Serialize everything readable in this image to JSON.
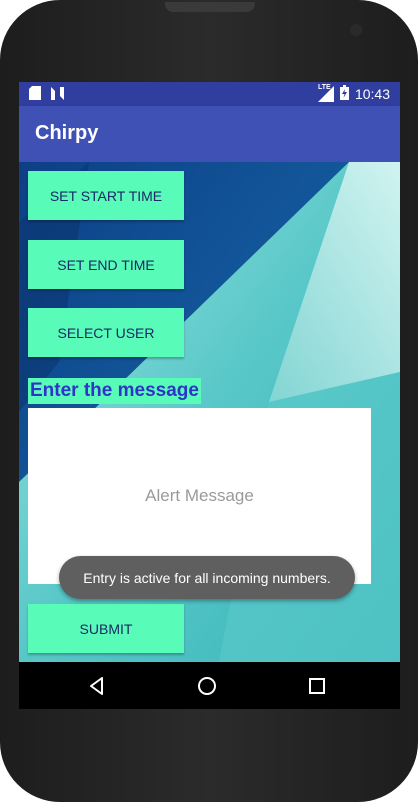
{
  "status_bar": {
    "time": "10:43",
    "network_label": "LTE",
    "icons": [
      "sd-card-icon",
      "n-notification-icon",
      "lte-signal-icon",
      "battery-icon"
    ]
  },
  "app_bar": {
    "title": "Chirpy"
  },
  "buttons": {
    "set_start_time": "SET START TIME",
    "set_end_time": "SET END TIME",
    "select_user": "SELECT USER",
    "submit": "SUBMIT"
  },
  "message": {
    "heading": "Enter the message",
    "placeholder": "Alert Message",
    "value": ""
  },
  "toast": {
    "text": "Entry is active for all incoming numbers."
  },
  "navigation": {
    "icons": [
      "back-icon",
      "home-icon",
      "recents-icon"
    ]
  },
  "colors": {
    "primary": "#3f51b5",
    "primary_dark": "#303f9f",
    "accent_button": "#59fbb8",
    "button_text": "#1a2a66",
    "heading_text": "#2f34c9"
  }
}
